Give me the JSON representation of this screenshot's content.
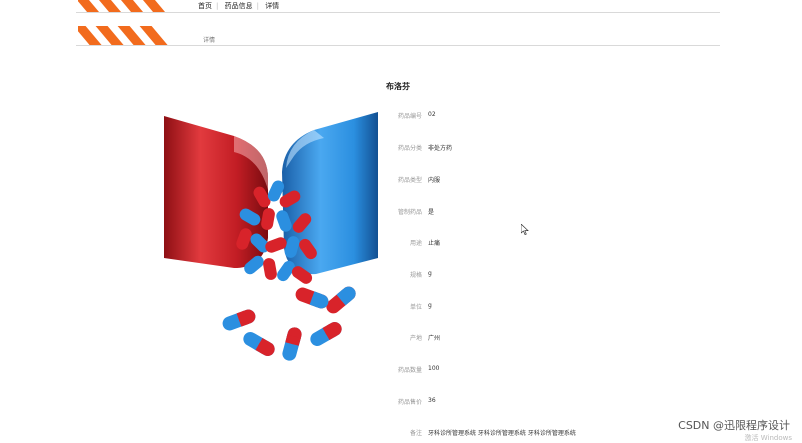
{
  "nav": {
    "items": [
      "首页",
      "药品信息",
      "详情"
    ]
  },
  "breadcrumb": "详情",
  "product": {
    "name": "布洛芬",
    "fields": [
      {
        "label": "药品编号",
        "value": "02"
      },
      {
        "label": "药品分类",
        "value": "非处方药"
      },
      {
        "label": "药品类型",
        "value": "内服"
      },
      {
        "label": "管制药品",
        "value": "是"
      },
      {
        "label": "用途",
        "value": "止痛"
      },
      {
        "label": "规格",
        "value": "g"
      },
      {
        "label": "单位",
        "value": "g"
      },
      {
        "label": "产地",
        "value": "广州"
      },
      {
        "label": "药品数量",
        "value": "100"
      },
      {
        "label": "药品售价",
        "value": "36"
      },
      {
        "label": "备注",
        "value": "牙科诊所管理系统 牙科诊所管理系统 牙科诊所管理系统"
      }
    ]
  },
  "watermark": {
    "text": "CSDN @迅限程序设计",
    "sub": "激活 Windows"
  },
  "colors": {
    "accent": "#f26b1d",
    "capsule_red": "#d8232a",
    "capsule_blue": "#2b8fe0"
  }
}
